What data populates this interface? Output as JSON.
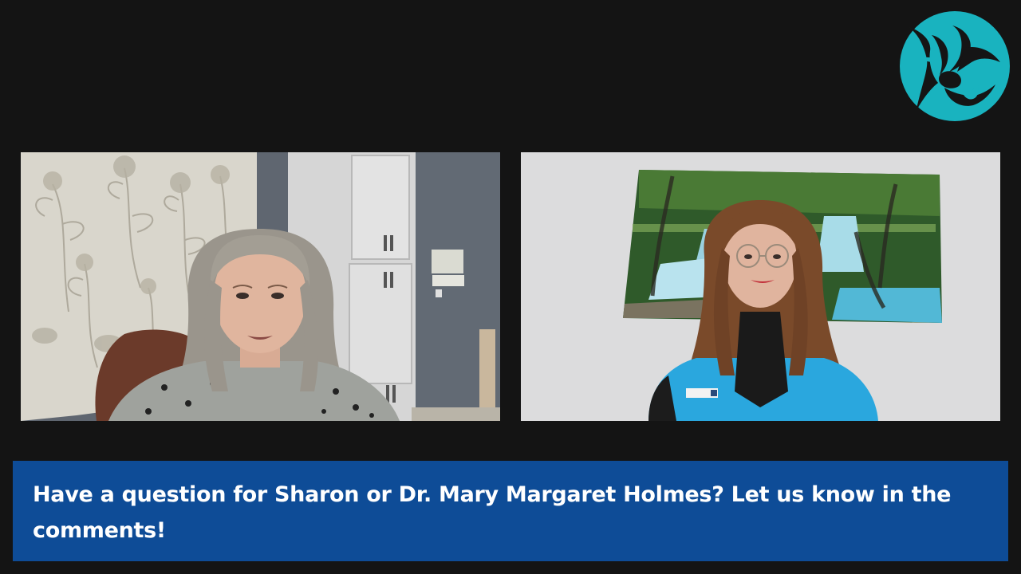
{
  "logo": {
    "icon": "orchid-flower-logo-icon",
    "background_color": "#19b3bf",
    "foreground_color": "#151515"
  },
  "video_tiles": [
    {
      "id": "participant-left",
      "scene": "woman-with-gray-hair-in-home-office"
    },
    {
      "id": "participant-right",
      "scene": "woman-in-blue-scrubs-in-front-of-waterfall-canvas"
    }
  ],
  "banner": {
    "text": "Have a question for Sharon or Dr. Mary Margaret Holmes? Let us know in the comments!",
    "background_color": "#0e4c97",
    "text_color": "#ffffff"
  }
}
